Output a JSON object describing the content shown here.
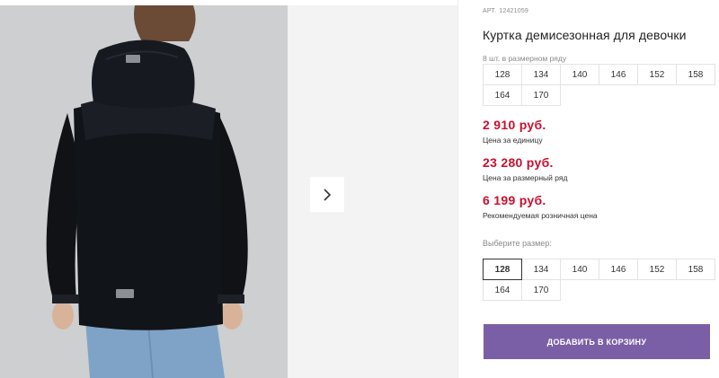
{
  "product": {
    "sku_label": "АРТ.",
    "sku": "12421059",
    "title": "Куртка демисезонная для девочки",
    "pack_info": "8 шт. в размерном ряду"
  },
  "pack_sizes": [
    "128",
    "134",
    "140",
    "146",
    "152",
    "158",
    "164",
    "170"
  ],
  "prices": {
    "unit_price": "2 910 руб.",
    "unit_caption": "Цена за единицу",
    "pack_price": "23 280 руб.",
    "pack_caption": "Цена за размерный ряд",
    "retail_price": "6 199 руб.",
    "retail_caption": "Рекомендуемая розничная цена"
  },
  "size_selector": {
    "label": "Выберите размер:",
    "options": [
      "128",
      "134",
      "140",
      "146",
      "152",
      "158",
      "164",
      "170"
    ],
    "selected": "128"
  },
  "cart": {
    "button_label": "ДОБАВИТЬ В КОРЗИНУ"
  },
  "gallery": {
    "next_icon": "chevron-right-icon",
    "photo_background": "#cfd0d1",
    "jacket_color": "#111418",
    "jeans_color": "#7fa3c6"
  },
  "colors": {
    "price": "#c8102e",
    "cart_button": "#7b5fa6"
  }
}
